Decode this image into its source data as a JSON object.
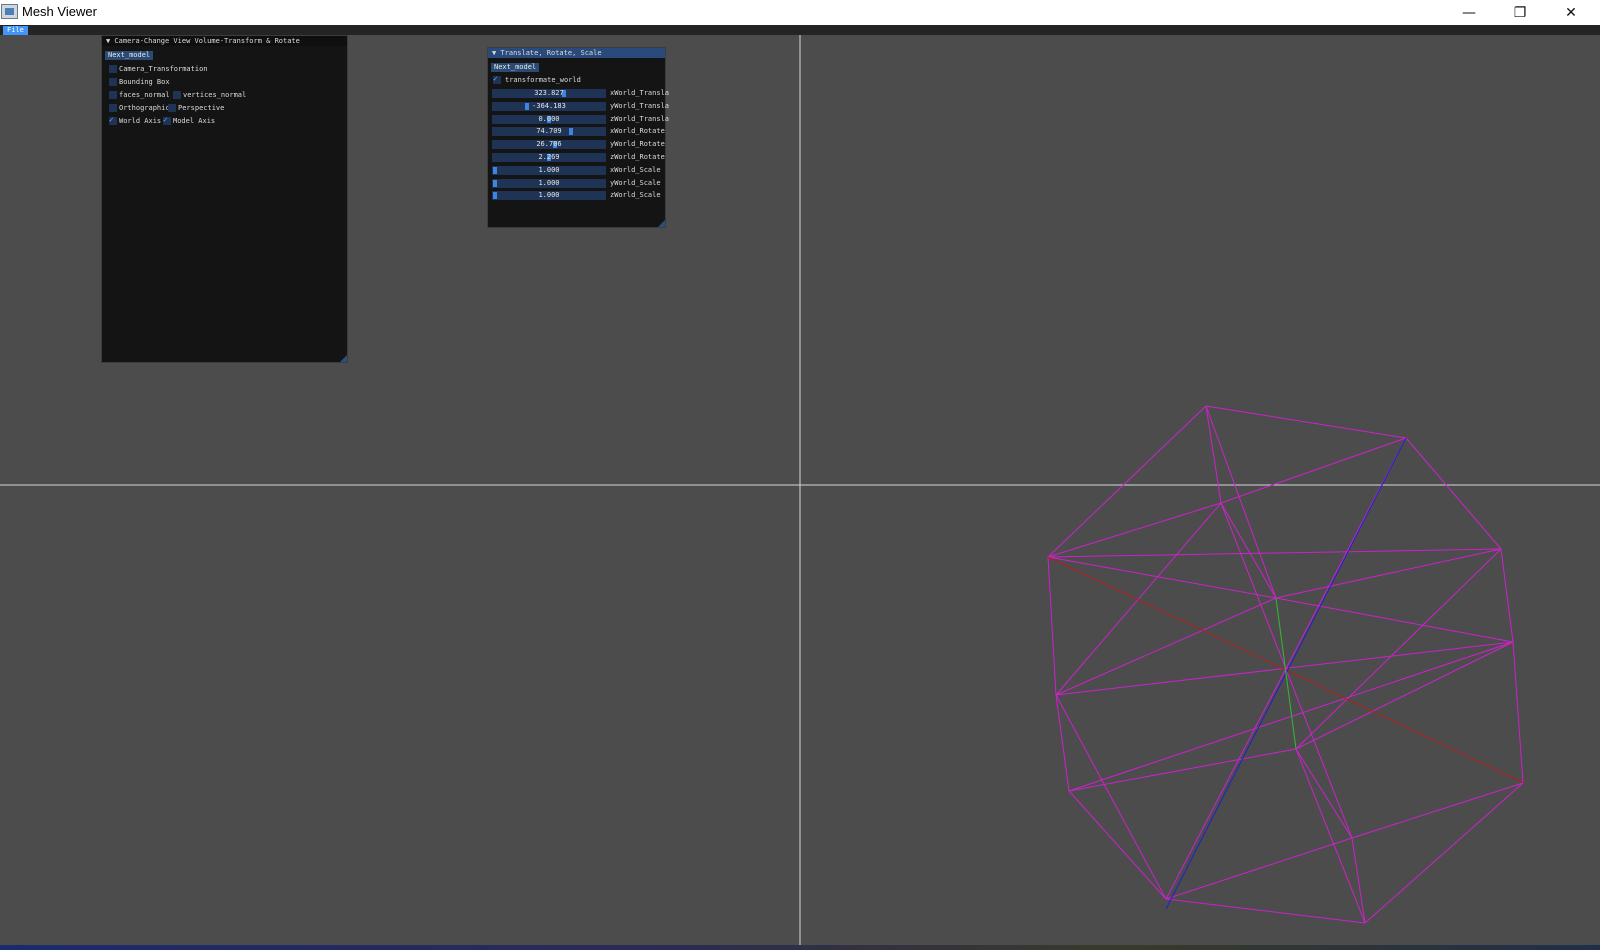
{
  "window": {
    "title": "Mesh Viewer",
    "minimize": "—",
    "restore": "❐",
    "close": "✕"
  },
  "menubar": {
    "file": "File"
  },
  "camera_panel": {
    "title": "▼ Camera-Change View Volume-Transform & Rotate",
    "next_model": "Next_model",
    "options": [
      {
        "label": "Camera_Transformation",
        "checked": false
      },
      {
        "label": "Bounding Box",
        "checked": false
      },
      {
        "label": "faces_normal",
        "checked": false
      },
      {
        "label": "vertices_normal",
        "checked": false
      },
      {
        "label": "Orthographic",
        "checked": false
      },
      {
        "label": "Perspective",
        "checked": false
      },
      {
        "label": "World Axis",
        "checked": true
      },
      {
        "label": "Model Axis",
        "checked": true
      }
    ]
  },
  "trs_panel": {
    "title": "▼ Translate, Rotate, Scale",
    "next_model": "Next_model",
    "transformate_world": {
      "label": "transformate_world",
      "checked": true
    },
    "sliders": [
      {
        "label": "xWorld_Transla",
        "value": "323.827",
        "fraction": 0.64
      },
      {
        "label": "yWorld_Transla",
        "value": "-364.183",
        "fraction": 0.3
      },
      {
        "label": "zWorld_Transla",
        "value": "0.000",
        "fraction": 0.5
      },
      {
        "label": "xWorld_Rotate",
        "value": "74.709",
        "fraction": 0.7
      },
      {
        "label": "yWorld_Rotate",
        "value": "26.706",
        "fraction": 0.56
      },
      {
        "label": "zWorld_Rotate",
        "value": "2.269",
        "fraction": 0.5
      },
      {
        "label": "xWorld_Scale",
        "value": "1.000",
        "fraction": 0.0
      },
      {
        "label": "yWorld_Scale",
        "value": "1.000",
        "fraction": 0.0
      },
      {
        "label": "zWorld_Scale",
        "value": "1.000",
        "fraction": 0.0
      }
    ]
  },
  "colors": {
    "background": "#4c4c4c",
    "world_axis": "#d8d8d8",
    "mesh": "#cc22cc",
    "model_axis_x": "#b02020",
    "model_axis_y": "#20c020",
    "model_axis_z": "#2020d0"
  }
}
